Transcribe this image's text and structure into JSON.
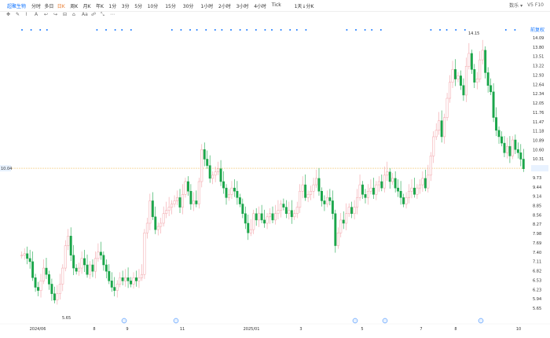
{
  "toolbar": {
    "symbol": "超聚生物",
    "periods": [
      "分时",
      "多日",
      "日K",
      "周K",
      "月K",
      "年K",
      "1分",
      "3分",
      "5分",
      "10分",
      "15分",
      "30分",
      "1小时",
      "2小时",
      "3小时",
      "4小时",
      "Tick",
      "1天↓分K"
    ],
    "active_period": "日K",
    "right_labels": [
      "数乐 ▾",
      "V5 F10"
    ]
  },
  "tools": [
    "✥",
    "✎",
    "⌇",
    "A",
    "↩",
    "↪",
    "⊟",
    "⌂",
    "Aa",
    "☍",
    "⤡",
    "⋯"
  ],
  "price_badge": "14.15",
  "corner_label": "前复权",
  "last_price": "10.04",
  "min_label": "5.65",
  "chart_data": {
    "type": "candlestick",
    "y_ticks": [
      "14.09",
      "13.80",
      "13.51",
      "13.22",
      "12.93",
      "12.64",
      "12.34",
      "12.05",
      "11.76",
      "11.47",
      "11.18",
      "10.89",
      "10.60",
      "10.31",
      "10.04",
      "9.73",
      "9.44",
      "9.14",
      "8.85",
      "8.56",
      "8.27",
      "7.98",
      "7.69",
      "7.40",
      "7.11",
      "6.82",
      "6.53",
      "6.23",
      "5.94",
      "5.65"
    ],
    "x_ticks": [
      "2024/06",
      "8",
      "9",
      "11",
      "2025/01",
      "3",
      "5",
      "7",
      "8",
      "10"
    ],
    "ylim": [
      5.65,
      14.09
    ],
    "max_price": 14.15,
    "min_price": 5.65,
    "up_color": "#f2a0a6",
    "down_color": "#1aa64a",
    "close_series": [
      7.3,
      7.35,
      7.2,
      7.1,
      6.6,
      6.3,
      6.2,
      6.5,
      6.9,
      6.7,
      6.4,
      6.1,
      5.9,
      6.1,
      6.4,
      6.9,
      7.6,
      7.9,
      7.3,
      6.9,
      6.8,
      6.9,
      7.2,
      7.0,
      6.7,
      7.0,
      6.8,
      7.2,
      7.4,
      7.3,
      7.0,
      6.8,
      6.5,
      6.3,
      6.2,
      6.4,
      6.6,
      6.5,
      6.6,
      6.5,
      6.4,
      6.6,
      6.5,
      6.6,
      6.7,
      8.0,
      8.3,
      9.0,
      8.5,
      8.1,
      8.2,
      8.3,
      8.6,
      8.7,
      8.8,
      8.9,
      9.0,
      9.1,
      8.8,
      9.2,
      9.6,
      9.3,
      8.9,
      9.0,
      8.9,
      9.6,
      10.6,
      10.3,
      10.1,
      9.7,
      9.8,
      9.9,
      10.0,
      9.6,
      9.4,
      9.1,
      9.2,
      9.4,
      9.3,
      9.1,
      8.9,
      8.6,
      8.3,
      8.0,
      8.1,
      8.6,
      8.4,
      8.6,
      8.4,
      8.3,
      8.5,
      8.6,
      8.4,
      8.6,
      8.7,
      8.9,
      8.8,
      8.6,
      8.7,
      8.5,
      8.6,
      8.8,
      9.3,
      9.5,
      9.1,
      9.2,
      9.3,
      9.5,
      9.7,
      9.3,
      9.0,
      8.9,
      9.1,
      9.0,
      8.6,
      7.6,
      8.0,
      8.4,
      8.3,
      8.6,
      8.8,
      8.6,
      8.8,
      9.1,
      9.5,
      9.2,
      9.1,
      9.3,
      9.4,
      9.2,
      9.5,
      9.6,
      9.4,
      9.8,
      9.9,
      9.6,
      9.7,
      9.4,
      9.3,
      9.1,
      8.9,
      9.1,
      9.3,
      9.4,
      9.2,
      9.4,
      9.5,
      9.7,
      9.4,
      9.8,
      10.4,
      11.0,
      11.2,
      11.5,
      11.0,
      11.6,
      12.2,
      12.7,
      13.1,
      12.8,
      12.9,
      12.6,
      12.3,
      13.2,
      13.6,
      13.1,
      12.7,
      12.8,
      13.4,
      13.7,
      13.0,
      12.6,
      12.4,
      11.6,
      11.2,
      11.0,
      10.8,
      10.5,
      10.7,
      10.4,
      10.9,
      10.6,
      10.5,
      10.3,
      10.0
    ]
  }
}
